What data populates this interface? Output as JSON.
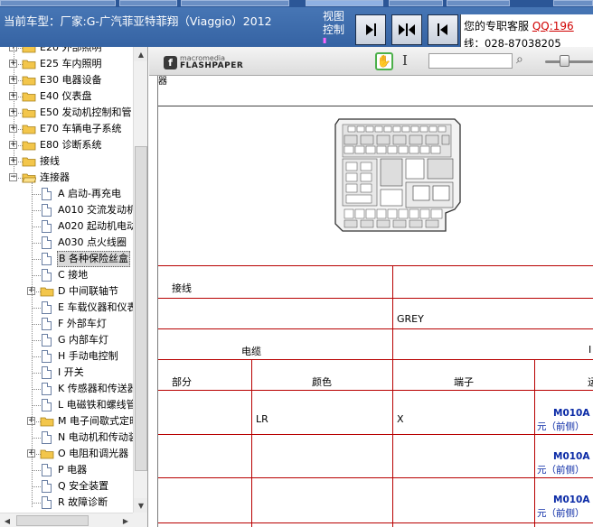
{
  "header": {
    "title": "当前车型：厂家:G-广汽菲亚特菲翔（Viaggio）2012",
    "view_label_line1": "视图",
    "view_label_line2": "控制",
    "customer_service": {
      "label": "您的专职客服",
      "qq": "QQ:196",
      "phone": "线：028-87038205"
    }
  },
  "tree": {
    "items": [
      {
        "label": "E20 外部照明",
        "type": "folder",
        "expander": "+"
      },
      {
        "label": "E25 车内照明",
        "type": "folder",
        "expander": "+"
      },
      {
        "label": "E30 电器设备",
        "type": "folder",
        "expander": "+"
      },
      {
        "label": "E40 仪表盘",
        "type": "folder",
        "expander": "+"
      },
      {
        "label": "E50 发动机控制和管",
        "type": "folder",
        "expander": "+"
      },
      {
        "label": "E70 车辆电子系统",
        "type": "folder",
        "expander": "+"
      },
      {
        "label": "E80 诊断系统",
        "type": "folder",
        "expander": "+"
      },
      {
        "label": "接线",
        "type": "folder",
        "expander": "+"
      },
      {
        "label": "连接器",
        "type": "folder",
        "expander": "-"
      },
      {
        "label": "A 启动-再充电",
        "type": "doc"
      },
      {
        "label": "A010 交流发动机",
        "type": "doc"
      },
      {
        "label": "A020 起动机电动",
        "type": "doc"
      },
      {
        "label": "A030 点火线圈",
        "type": "doc"
      },
      {
        "label": "B 各种保险丝盒",
        "type": "doc",
        "selected": true
      },
      {
        "label": "C 接地",
        "type": "doc"
      },
      {
        "label": "D 中间联轴节",
        "type": "folder",
        "expander": "+"
      },
      {
        "label": "E 车载仪器和仪表",
        "type": "doc"
      },
      {
        "label": "F 外部车灯",
        "type": "doc"
      },
      {
        "label": "G 内部车灯",
        "type": "doc"
      },
      {
        "label": "H 手动电控制",
        "type": "doc"
      },
      {
        "label": "I 开关",
        "type": "doc"
      },
      {
        "label": "K 传感器和传送器",
        "type": "doc"
      },
      {
        "label": "L 电磁铁和螺线管",
        "type": "doc"
      },
      {
        "label": "M 电子间歇式定时",
        "type": "folder",
        "expander": "+"
      },
      {
        "label": "N 电动机和传动装",
        "type": "doc"
      },
      {
        "label": "O 电阻和调光器",
        "type": "folder",
        "expander": "+"
      },
      {
        "label": "P 电器",
        "type": "doc"
      },
      {
        "label": "Q 安全装置",
        "type": "doc"
      },
      {
        "label": "R 故障诊断",
        "type": "doc"
      }
    ]
  },
  "flashpaper": {
    "brand_top": "macromedia",
    "brand_bottom": "FLASHPAPER",
    "search_value": ""
  },
  "document": {
    "cut_label": "器",
    "table": {
      "row1_col1": "接线",
      "row2_col2": "GREY",
      "row3_col1": "电缆",
      "row3_col3": "I",
      "header_part": "部分",
      "header_color": "颜色",
      "header_terminal": "端子",
      "header_last": "运",
      "data_color": "LR",
      "data_terminal": "X",
      "rows": [
        {
          "code": "M010A",
          "sub": "元（前侧）"
        },
        {
          "code": "M010A",
          "sub": "元（前侧）"
        },
        {
          "code": "M010A",
          "sub": "元（前侧）"
        }
      ]
    }
  },
  "colors": {
    "header_bg": "#3f6eae",
    "table_line": "#b80000",
    "link_blue": "#0a2aa6",
    "qq_red": "#d00000"
  }
}
